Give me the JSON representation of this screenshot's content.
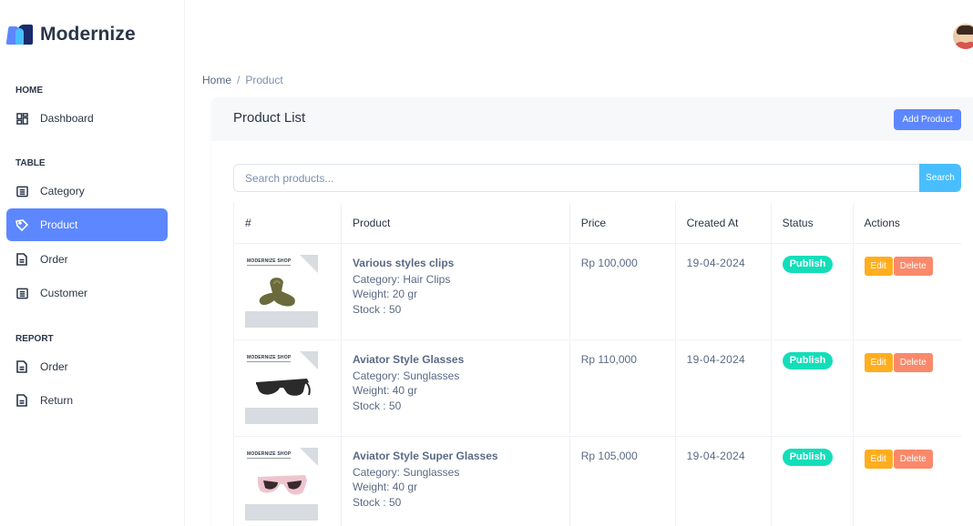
{
  "brand": {
    "name": "Modernize"
  },
  "sidebar": {
    "sections": [
      "HOME",
      "TABLE",
      "REPORT"
    ],
    "home_items": [
      {
        "label": "Dashboard",
        "icon": "layout-dashboard-icon"
      }
    ],
    "table_items": [
      {
        "label": "Category",
        "icon": "list-details-icon"
      },
      {
        "label": "Product",
        "icon": "tag-icon",
        "active": true
      },
      {
        "label": "Order",
        "icon": "file-text-icon"
      },
      {
        "label": "Customer",
        "icon": "list-details-icon"
      }
    ],
    "report_items": [
      {
        "label": "Order",
        "icon": "file-text-icon"
      },
      {
        "label": "Return",
        "icon": "file-text-icon"
      }
    ]
  },
  "breadcrumb": {
    "home": "Home",
    "separator": "/",
    "current": "Product"
  },
  "card": {
    "title": "Product List",
    "add_button": "Add Product",
    "search_placeholder": "Search products...",
    "search_button": "Search"
  },
  "table": {
    "headers": [
      "#",
      "Product",
      "Price",
      "Created At",
      "Status",
      "Actions"
    ],
    "rows": [
      {
        "shop_label": "MODERNIZE SHOP",
        "name": "Various styles clips",
        "category": "Category: Hair Clips",
        "weight": "Weight: 20 gr",
        "stock": "Stock : 50",
        "price": "Rp 100,000",
        "created_at": "19-04-2024",
        "status": "Publish",
        "edit": "Edit",
        "delete": "Delete"
      },
      {
        "shop_label": "MODERNIZE SHOP",
        "name": "Aviator Style Glasses",
        "category": "Category: Sunglasses",
        "weight": "Weight: 40 gr",
        "stock": "Stock : 50",
        "price": "Rp 110,000",
        "created_at": "19-04-2024",
        "status": "Publish",
        "edit": "Edit",
        "delete": "Delete"
      },
      {
        "shop_label": "MODERNIZE SHOP",
        "name": "Aviator Style Super Glasses",
        "category": "Category: Sunglasses",
        "weight": "Weight: 40 gr",
        "stock": "Stock : 50",
        "price": "Rp 105,000",
        "created_at": "19-04-2024",
        "status": "Publish",
        "edit": "Edit",
        "delete": "Delete"
      }
    ]
  },
  "colors": {
    "primary": "#5d87ff",
    "secondary": "#49beff",
    "success": "#13deb9",
    "warning": "#ffae1f",
    "danger": "#fa896b"
  }
}
